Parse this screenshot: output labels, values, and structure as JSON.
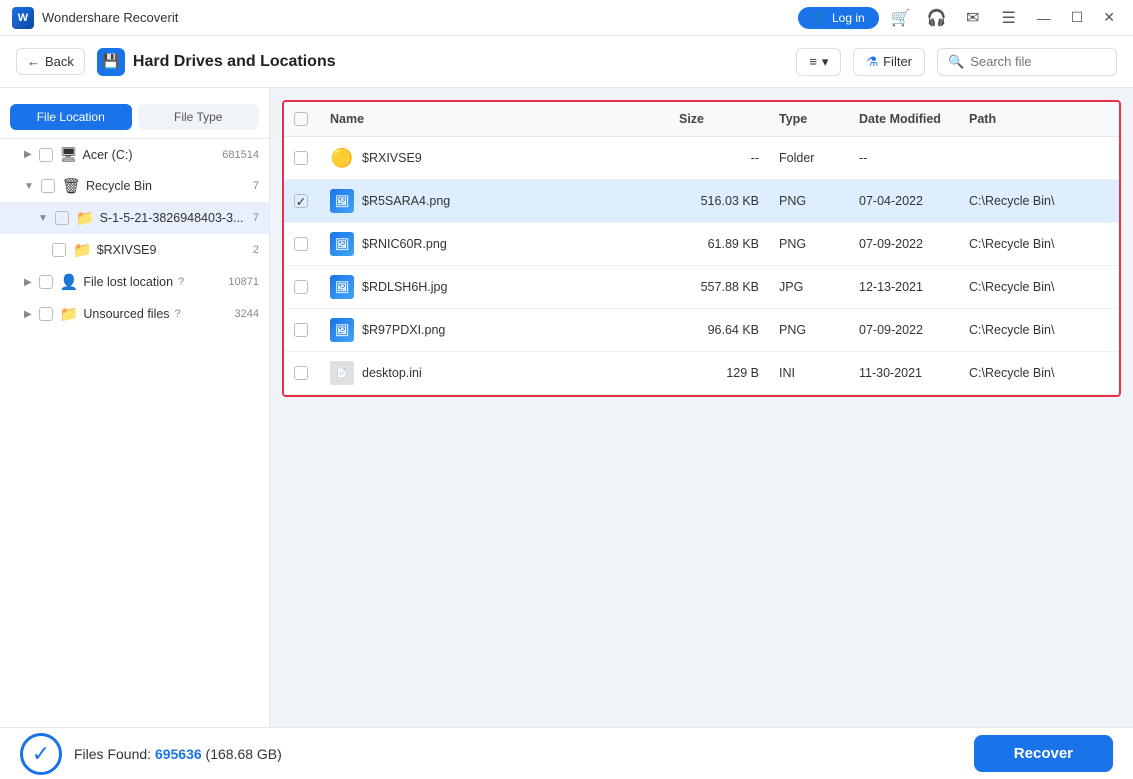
{
  "app": {
    "title": "Wondershare Recoverit",
    "logo": "W"
  },
  "titlebar": {
    "login_label": "Log in",
    "minimize": "—",
    "maximize": "☐",
    "close": "✕",
    "icons": [
      "cart",
      "headset",
      "mail",
      "menu"
    ]
  },
  "headerbar": {
    "back_label": "Back",
    "section_title": "Hard Drives and Locations",
    "sort_label": "≡",
    "filter_label": "Filter",
    "search_placeholder": "Search file"
  },
  "sidebar": {
    "tab_file_location": "File Location",
    "tab_file_type": "File Type",
    "items": [
      {
        "id": "acer",
        "label": "Acer (C:)",
        "count": "681514",
        "indent": 1,
        "icon": "drive"
      },
      {
        "id": "recycle-bin",
        "label": "Recycle Bin",
        "count": "7",
        "indent": 1,
        "icon": "recycle",
        "expanded": true
      },
      {
        "id": "sid",
        "label": "S-1-5-21-3826948403-3...",
        "count": "7",
        "indent": 2,
        "icon": "folder",
        "expanded": true
      },
      {
        "id": "rxivse9",
        "label": "$RXIVSE9",
        "count": "2",
        "indent": 3,
        "icon": "folder"
      },
      {
        "id": "file-lost",
        "label": "File lost location",
        "count": "10871",
        "indent": 1,
        "icon": "user"
      },
      {
        "id": "unsourced",
        "label": "Unsourced files",
        "count": "3244",
        "indent": 1,
        "icon": "folder"
      }
    ]
  },
  "table": {
    "columns": [
      "",
      "Name",
      "Size",
      "Type",
      "Date Modified",
      "Path"
    ],
    "rows": [
      {
        "id": 1,
        "name": "$RXIVSE9",
        "size": "--",
        "type": "Folder",
        "date": "--",
        "path": "",
        "icon": "folder",
        "selected": false
      },
      {
        "id": 2,
        "name": "$R5SARA4.png",
        "size": "516.03 KB",
        "type": "PNG",
        "date": "07-04-2022",
        "path": "C:\\Recycle Bin\\",
        "icon": "image",
        "selected": true
      },
      {
        "id": 3,
        "name": "$RNIC60R.png",
        "size": "61.89 KB",
        "type": "PNG",
        "date": "07-09-2022",
        "path": "C:\\Recycle Bin\\",
        "icon": "image",
        "selected": false
      },
      {
        "id": 4,
        "name": "$RDLSH6H.jpg",
        "size": "557.88 KB",
        "type": "JPG",
        "date": "12-13-2021",
        "path": "C:\\Recycle Bin\\",
        "icon": "image",
        "selected": false
      },
      {
        "id": 5,
        "name": "$R97PDXI.png",
        "size": "96.64 KB",
        "type": "PNG",
        "date": "07-09-2022",
        "path": "C:\\Recycle Bin\\",
        "icon": "image",
        "selected": false
      },
      {
        "id": 6,
        "name": "desktop.ini",
        "size": "129 B",
        "type": "INI",
        "date": "11-30-2021",
        "path": "C:\\Recycle Bin\\",
        "icon": "ini",
        "selected": false
      }
    ]
  },
  "footer": {
    "found_label": "Files Found:",
    "found_count": "695636",
    "found_size": "(168.68 GB)",
    "recover_label": "Recover"
  }
}
